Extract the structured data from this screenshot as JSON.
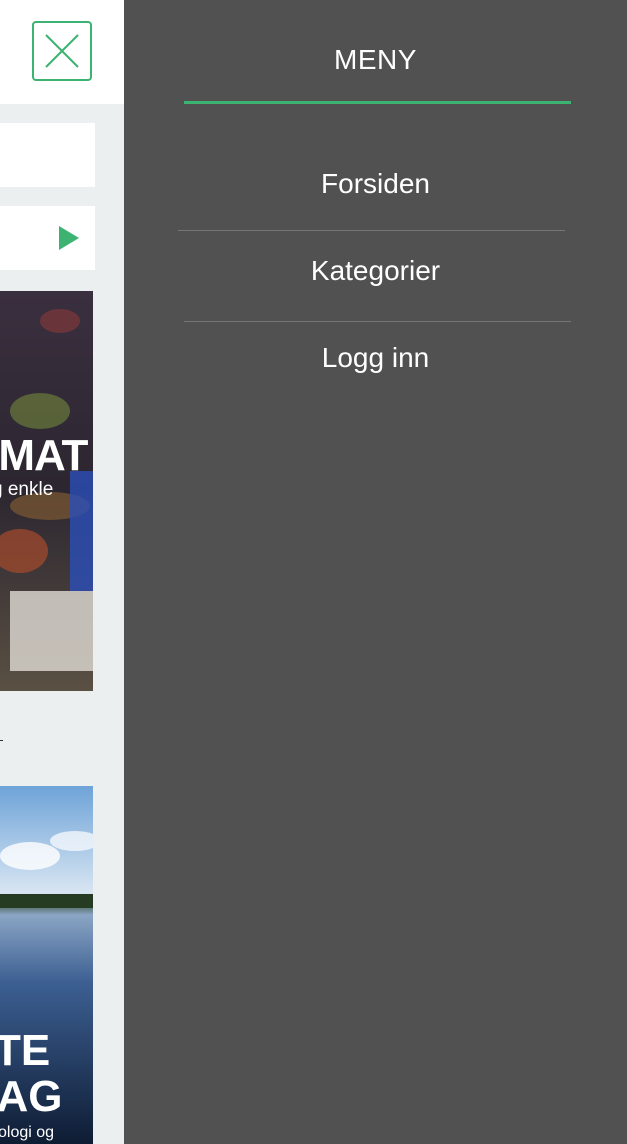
{
  "menu": {
    "title": "MENY",
    "items": [
      {
        "label": "Forsiden"
      },
      {
        "label": "Kategorier"
      },
      {
        "label": "Logg inn"
      }
    ]
  },
  "background_page": {
    "banner1": {
      "headline": "SMAT",
      "sub": "g enkle"
    },
    "banner2": {
      "line1": "TE",
      "line2": "FAG",
      "line3": "ologi og"
    }
  },
  "colors": {
    "accent": "#3cb371",
    "menu_bg": "#515151",
    "page_bg": "#eceff0"
  },
  "icons": {
    "close": "close-icon",
    "play": "play-icon"
  }
}
